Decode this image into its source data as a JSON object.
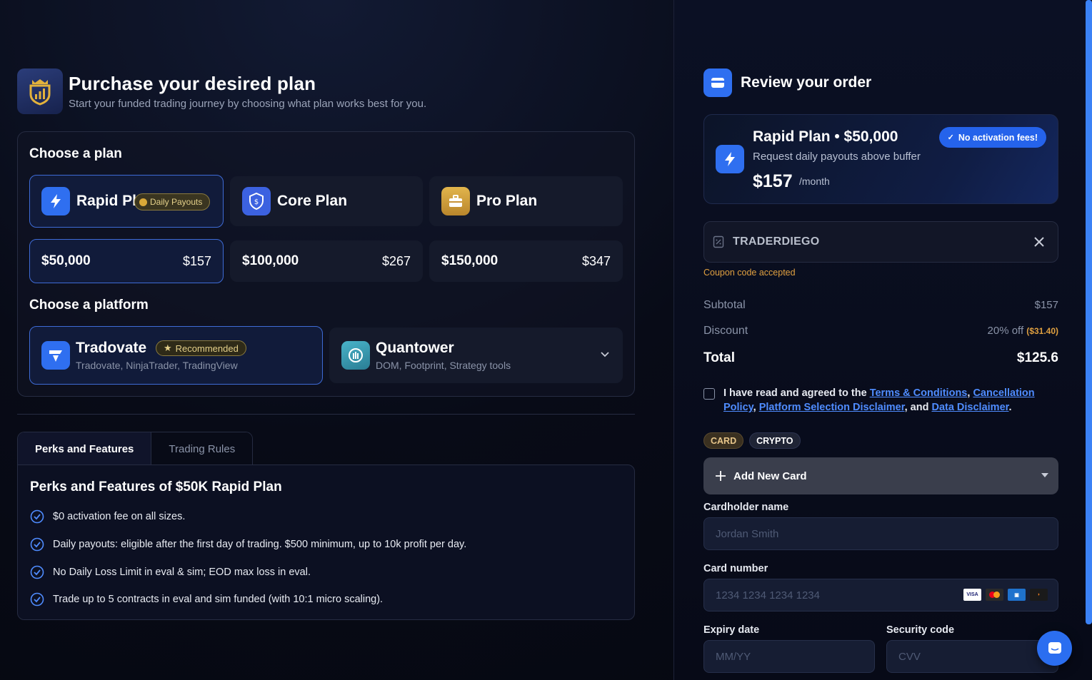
{
  "header": {
    "title": "Purchase your desired plan",
    "subtitle": "Start your funded trading journey by choosing what plan works best for you."
  },
  "plans": {
    "section_title": "Choose a plan",
    "items": [
      {
        "label": "Rapid Plan",
        "badge": "Daily Payouts",
        "icon": "lightning-icon",
        "selected": true
      },
      {
        "label": "Core Plan",
        "icon": "shield-dollar-icon",
        "selected": false
      },
      {
        "label": "Pro Plan",
        "icon": "briefcase-icon",
        "selected": false
      }
    ],
    "sizes": [
      {
        "amount": "$50,000",
        "price": "$157",
        "selected": true
      },
      {
        "amount": "$100,000",
        "price": "$267",
        "selected": false
      },
      {
        "amount": "$150,000",
        "price": "$347",
        "selected": false
      }
    ]
  },
  "platforms": {
    "section_title": "Choose a platform",
    "items": [
      {
        "name": "Tradovate",
        "badge": "Recommended",
        "sub": "Tradovate, NinjaTrader, TradingView",
        "selected": true
      },
      {
        "name": "Quantower",
        "sub": "DOM, Footprint, Strategy tools",
        "selected": false
      }
    ]
  },
  "tabs": [
    {
      "label": "Perks and Features",
      "active": true
    },
    {
      "label": "Trading Rules",
      "active": false
    }
  ],
  "perks": {
    "title": "Perks and Features of $50K Rapid Plan",
    "items": [
      "$0 activation fee on all sizes.",
      "Daily payouts: eligible after the first day of trading. $500 minimum, up to 10k profit per day.",
      "No Daily Loss Limit in eval & sim; EOD max loss in eval.",
      "Trade up to 5 contracts in eval and sim funded (with 10:1 micro scaling)."
    ]
  },
  "order": {
    "title": "Review your order",
    "plan_name": "Rapid Plan • $50,000",
    "plan_desc": "Request daily payouts above buffer",
    "price": "$157",
    "per": "/month",
    "badge": "No activation fees!",
    "coupon_code": "TRADERDIEGO",
    "coupon_status": "Coupon code accepted",
    "subtotal_label": "Subtotal",
    "subtotal_value": "$157",
    "discount_label": "Discount",
    "discount_value": "20% off",
    "discount_amount": "($31.40)",
    "total_label": "Total",
    "total_value": "$125.6"
  },
  "agreement": {
    "prefix": "I have read and agreed to the",
    "terms": "Terms & Conditions",
    "sep1": ",",
    "cancellation": "Cancellation Policy",
    "sep2": ",",
    "platform": "Platform Selection Disclaimer",
    "sep3": ", and",
    "data": "Data Disclaimer",
    "end": "."
  },
  "payment": {
    "tabs": [
      "CARD",
      "CRYPTO"
    ],
    "add_card": "Add New Card",
    "cardholder_label": "Cardholder name",
    "cardholder_placeholder": "Jordan Smith",
    "card_number_label": "Card number",
    "card_number_placeholder": "1234 1234 1234 1234",
    "card_logos": [
      "VISA",
      "mastercard",
      "amex",
      "discover"
    ],
    "expiry_label": "Expiry date",
    "expiry_placeholder": "MM/YY",
    "cvv_label": "Security code",
    "cvv_placeholder": "CVV"
  },
  "colors": {
    "accent": "#2f6ff0",
    "selected_border": "#3e6bd6",
    "gold": "#e0a040",
    "link": "#4f8cff"
  }
}
